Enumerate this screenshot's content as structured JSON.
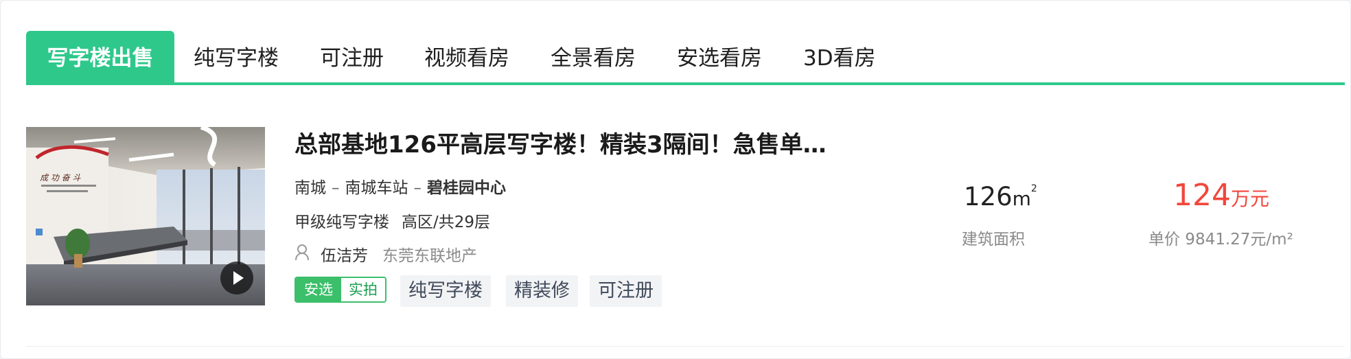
{
  "tabs": [
    {
      "label": "写字楼出售",
      "active": true
    },
    {
      "label": "纯写字楼",
      "active": false
    },
    {
      "label": "可注册",
      "active": false
    },
    {
      "label": "视频看房",
      "active": false
    },
    {
      "label": "全景看房",
      "active": false
    },
    {
      "label": "安选看房",
      "active": false
    },
    {
      "label": "3D看房",
      "active": false
    }
  ],
  "listing": {
    "title": "总部基地126平高层写字楼！精装3隔间！急售单…",
    "location": {
      "district": "南城",
      "area": "南城车站",
      "community": "碧桂园中心",
      "separator": "–"
    },
    "meta": {
      "grade": "甲级纯写字楼",
      "floor": "高区/共29层"
    },
    "agent": {
      "name": "伍洁芳",
      "company": "东莞东联地产"
    },
    "badge": {
      "left": "安选",
      "right": "实拍"
    },
    "tags": [
      "纯写字楼",
      "精装修",
      "可注册"
    ],
    "area": {
      "value": "126",
      "unit": "m",
      "sup": "2",
      "label": "建筑面积"
    },
    "price": {
      "value": "124",
      "unit": "万元",
      "unit_price": "单价 9841.27元/m²"
    }
  },
  "colors": {
    "accent": "#2ec88b",
    "price": "#f1473c",
    "badge_green": "#3cbf6a"
  },
  "icons": {
    "play": "play-icon",
    "agent": "user-icon"
  }
}
